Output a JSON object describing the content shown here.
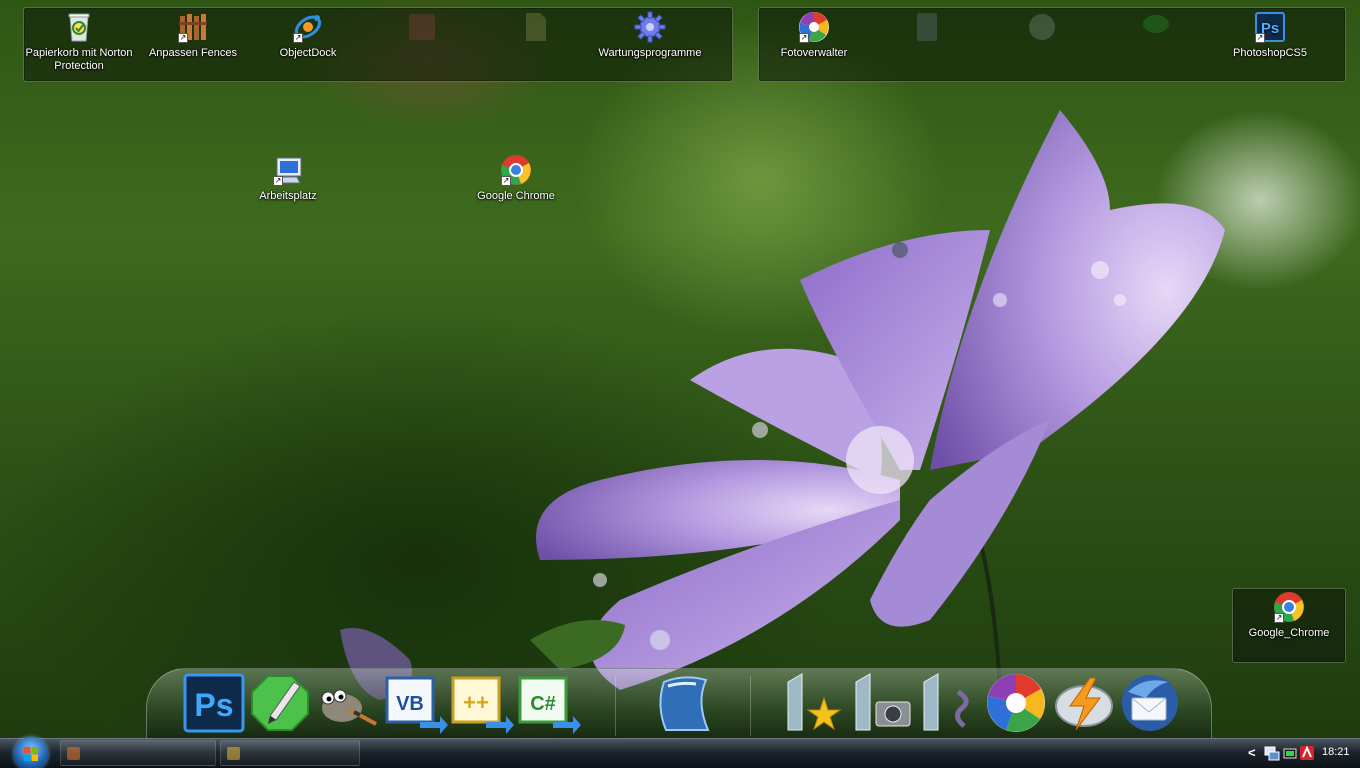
{
  "desktop": {
    "fence_left": [
      {
        "label": "Papierkorb mit Norton Protection",
        "icon": "norton-recycle-bin-icon",
        "shortcut": false,
        "faded": false
      },
      {
        "label": "Anpassen Fences",
        "icon": "fences-icon",
        "shortcut": true,
        "faded": false
      },
      {
        "label": "ObjectDock",
        "icon": "objectdock-icon",
        "shortcut": true,
        "faded": false
      },
      {
        "label": "",
        "icon": "faded-app-icon",
        "shortcut": false,
        "faded": true
      },
      {
        "label": "",
        "icon": "faded-file-icon",
        "shortcut": false,
        "faded": true
      },
      {
        "label": "Wartungsprogramme",
        "icon": "gear-icon",
        "shortcut": false,
        "faded": false
      }
    ],
    "fence_right": [
      {
        "label": "Fotoverwalter",
        "icon": "picasa-icon",
        "shortcut": true,
        "faded": false
      },
      {
        "label": "",
        "icon": "faded-app-icon",
        "shortcut": false,
        "faded": true
      },
      {
        "label": "",
        "icon": "faded-app-icon",
        "shortcut": false,
        "faded": true
      },
      {
        "label": "",
        "icon": "faded-app-icon",
        "shortcut": false,
        "faded": true
      },
      {
        "label": "PhotoshopCS5",
        "icon": "photoshop-icon",
        "shortcut": true,
        "faded": false
      }
    ],
    "free_icons": [
      {
        "label": "Arbeitsplatz",
        "icon": "computer-icon",
        "shortcut": true
      },
      {
        "label": "Google Chrome",
        "icon": "chrome-icon",
        "shortcut": true
      }
    ],
    "fence_single": {
      "label": "Google_Chrome",
      "icon": "chrome-icon",
      "shortcut": true
    }
  },
  "dock": {
    "items": [
      {
        "icon": "photoshop-icon",
        "text": "Ps"
      },
      {
        "icon": "inkscape-pen-icon",
        "text": ""
      },
      {
        "icon": "gimp-icon",
        "text": ""
      },
      {
        "icon": "visual-basic-icon",
        "text": "VB"
      },
      {
        "icon": "visual-cpp-icon",
        "text": "++"
      },
      {
        "icon": "visual-csharp-icon",
        "text": "C#"
      },
      {
        "icon": "openoffice-icon",
        "text": ""
      },
      {
        "icon": "library-favorites-icon",
        "text": ""
      },
      {
        "icon": "library-pictures-icon",
        "text": ""
      },
      {
        "icon": "library-music-icon",
        "text": ""
      },
      {
        "icon": "picasa-icon",
        "text": ""
      },
      {
        "icon": "winamp-icon",
        "text": ""
      },
      {
        "icon": "thunderbird-icon",
        "text": ""
      }
    ]
  },
  "taskbar": {
    "buttons": [
      {
        "label": "",
        "icon": "firefox-icon"
      },
      {
        "label": "",
        "icon": "folder-icon"
      }
    ],
    "tray": {
      "expand_symbol": "<",
      "icons": [
        "network-icon",
        "battery-icon",
        "antivirus-icon"
      ],
      "clock": "18:21"
    }
  },
  "colors": {
    "fence_bg": "#0c1808",
    "taskbar": "#1d252d",
    "petal": "#a98ad8"
  }
}
